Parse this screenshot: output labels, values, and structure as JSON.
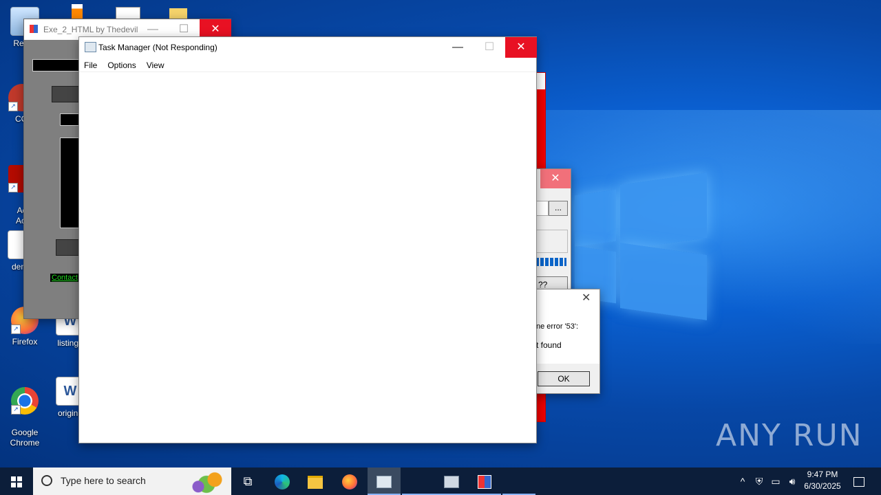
{
  "desktop_icons": [
    {
      "name": "recycle-bin-icon",
      "label": "Recyc"
    },
    {
      "name": "ccleaner-icon",
      "label": "CCl"
    },
    {
      "name": "adobe-acrobat-icon",
      "label": "Ad\nAcr"
    },
    {
      "name": "dema-file-icon",
      "label": "dema"
    },
    {
      "name": "firefox-desktop-icon",
      "label": "Firefox"
    },
    {
      "name": "listinga-icon",
      "label": "listinga"
    },
    {
      "name": "chrome-desktop-icon",
      "label": "Google\nChrome"
    },
    {
      "name": "original-doc-icon",
      "label": "origina"
    }
  ],
  "exe2html": {
    "title": "Exe_2_HTML by Thedevil",
    "contact": "Contact"
  },
  "error_window": {
    "browse_label": "...",
    "button_label": "??"
  },
  "error_dialog": {
    "line1": "ne error '53':",
    "line2": "t found",
    "ok_label": "OK"
  },
  "task_manager": {
    "title": "Task Manager (Not Responding)",
    "menu": [
      "File",
      "Options",
      "View"
    ]
  },
  "taskbar": {
    "search_placeholder": "Type here to search",
    "time": "9:47 PM",
    "date": "6/30/2025"
  },
  "watermark": "ANY RUN",
  "colors": {
    "close_red": "#e81123",
    "desktop_blue": "#0747a6",
    "progress_blue": "#0a64c8"
  }
}
